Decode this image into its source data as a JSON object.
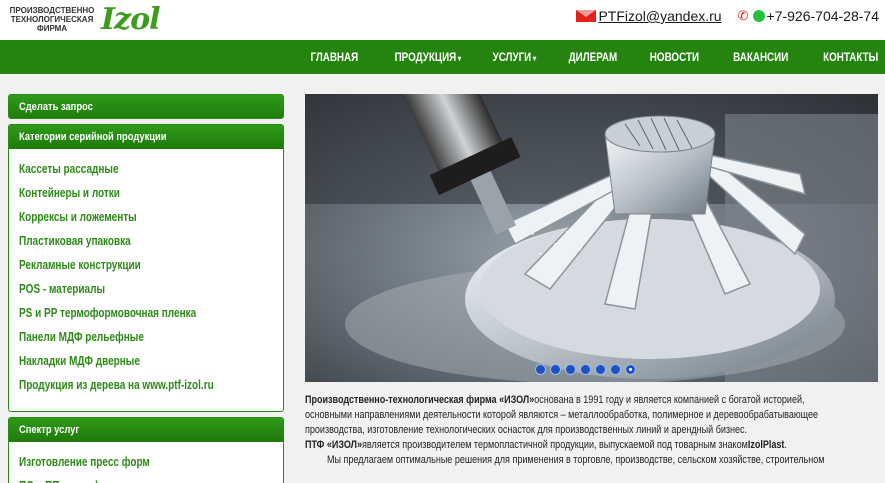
{
  "header": {
    "logo_text_lines": [
      "ПРОИЗВОДСТВЕННО",
      "ТЕХНОЛОГИЧЕСКАЯ",
      "ФИРМА"
    ],
    "logo_mark": "Izol",
    "email": "PTFizol@yandex.ru",
    "phone": "+7-926-704-28-74"
  },
  "nav": {
    "items": [
      {
        "label": "ГЛАВНАЯ",
        "dropdown": false
      },
      {
        "label": "ПРОДУКЦИЯ",
        "dropdown": true
      },
      {
        "label": "УСЛУГИ",
        "dropdown": true
      },
      {
        "label": "ДИЛЕРАМ",
        "dropdown": false
      },
      {
        "label": "НОВОСТИ",
        "dropdown": false
      },
      {
        "label": "ВАКАНСИИ",
        "dropdown": false
      },
      {
        "label": "КОНТАКТЫ",
        "dropdown": false
      }
    ],
    "caret": "▾"
  },
  "sidebar": {
    "request_label": "Сделать запрос",
    "categories_title": "Категории серийной продукции",
    "categories": [
      "Кассеты рассадные",
      "Контейнеры и лотки",
      "Коррексы и ложементы",
      "Пластиковая упаковка",
      "Рекламные конструкции",
      "POS - материалы",
      "PS и PP термоформовочная пленка",
      "Панели МДФ рельефные",
      "Накладки МДФ дверные",
      "Продукция из дерева на www.ptf-izol.ru"
    ],
    "services_title": "Спектр услуг",
    "services": [
      "Изготовление пресс форм",
      "ПС и ПП термоформ"
    ]
  },
  "slider": {
    "dot_count": 7,
    "active_index": 6
  },
  "intro": {
    "p1_bold": "Производственно-технологическая фирма «ИЗОЛ»",
    "p1_rest": " основана в 1991 году и является компанией с богатой историей,",
    "p2": "основными направлениями деятельности которой являются – металлообработка, полимерное и деревообрабатывающее",
    "p3": "производства, изготовление технологических оснасток для производственных линий и арендный бизнес.",
    "p4_bold": "ПТФ «ИЗОЛ»",
    "p4_rest": " является производителем термопластичной продукции, выпускаемой под товарным знаком ",
    "p4_brand": "IzolPlast",
    "p4_end": ".",
    "p5": "Мы предлагаем оптимальные решения для применения в торговле, производстве, сельском хозяйстве, строительном"
  },
  "colors": {
    "brand_green": "#25840f",
    "link_green": "#2c8a16",
    "accent_red": "#e0221a",
    "dot_blue": "#1d52c0"
  }
}
